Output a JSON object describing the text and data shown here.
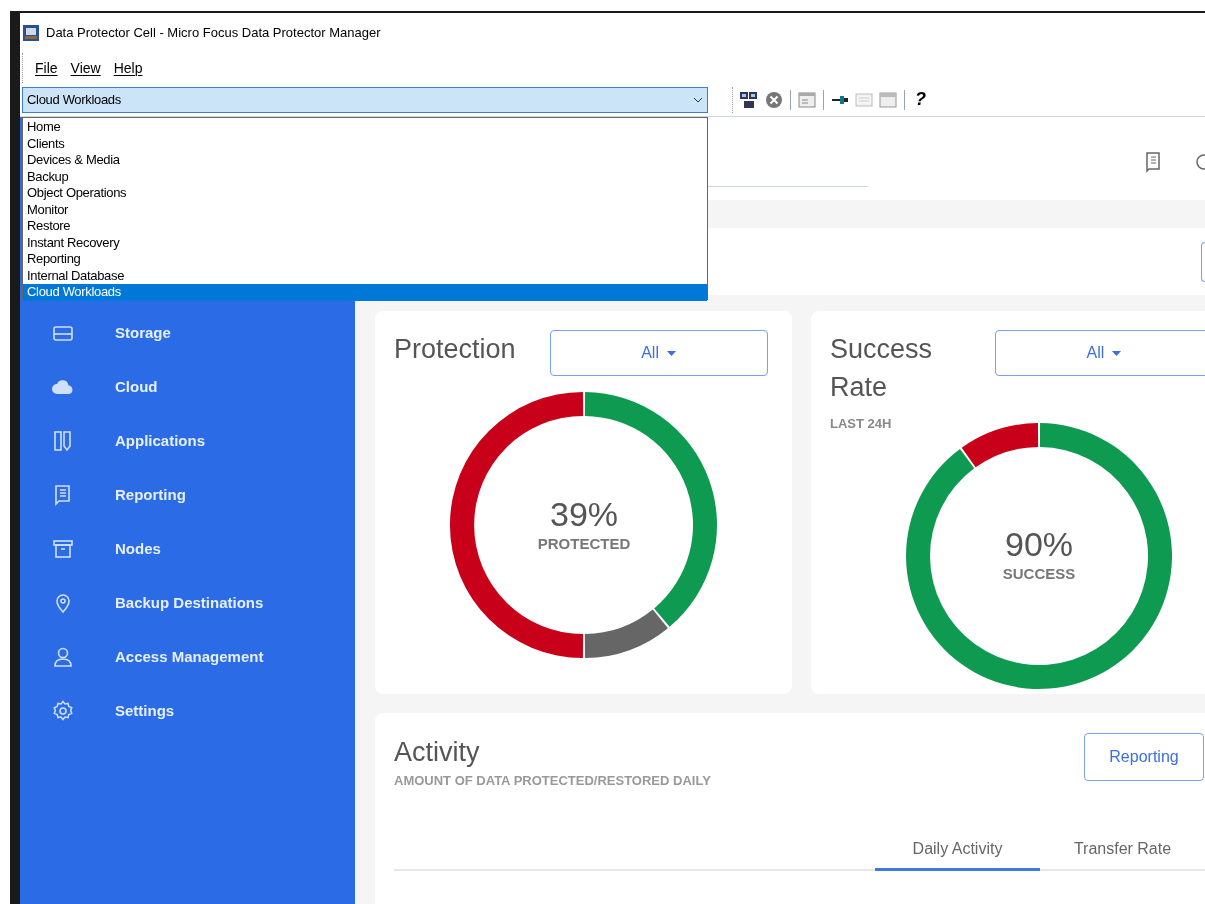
{
  "window": {
    "title": "Data Protector Cell - Micro Focus Data Protector Manager"
  },
  "menu": [
    "File",
    "View",
    "Help"
  ],
  "context_selector": {
    "value": "Cloud Workloads",
    "expanded": true,
    "options": [
      {
        "label": "Home",
        "selected": false
      },
      {
        "label": "Clients",
        "selected": false
      },
      {
        "label": "Devices & Media",
        "selected": false
      },
      {
        "label": "Backup",
        "selected": false
      },
      {
        "label": "Object Operations",
        "selected": false
      },
      {
        "label": "Monitor",
        "selected": false
      },
      {
        "label": "Restore",
        "selected": false
      },
      {
        "label": "Instant Recovery",
        "selected": false
      },
      {
        "label": "Reporting",
        "selected": false
      },
      {
        "label": "Internal Database",
        "selected": false
      },
      {
        "label": "Cloud Workloads",
        "selected": true
      }
    ]
  },
  "toolbar": {
    "help": "?"
  },
  "sidebar": {
    "items": [
      {
        "label": "Storage",
        "kind": "storage"
      },
      {
        "label": "Cloud",
        "kind": "cloud"
      },
      {
        "label": "Applications",
        "kind": "apps"
      },
      {
        "label": "Reporting",
        "kind": "report"
      },
      {
        "label": "Nodes",
        "kind": "nodes"
      },
      {
        "label": "Backup Destinations",
        "kind": "pin"
      },
      {
        "label": "Access Management",
        "kind": "user"
      },
      {
        "label": "Settings",
        "kind": "gear"
      }
    ]
  },
  "protection": {
    "title": "Protection",
    "filter": "All",
    "percent": "39%",
    "caption": "PROTECTED",
    "chart_data": {
      "type": "donut",
      "values": [
        39,
        11,
        50
      ],
      "colors": [
        "#0f9a51",
        "#666666",
        "#c8001a"
      ]
    }
  },
  "success_rate": {
    "title": "Success Rate",
    "subtitle": "LAST 24H",
    "filter": "All",
    "percent": "90%",
    "caption": "SUCCESS",
    "chart_data": {
      "type": "donut",
      "values": [
        90,
        10
      ],
      "colors": [
        "#0f9a51",
        "#c8001a"
      ]
    }
  },
  "activity": {
    "title": "Activity",
    "subtitle": "AMOUNT OF DATA PROTECTED/RESTORED DAILY",
    "button": "Reporting",
    "tabs": [
      {
        "label": "Daily Activity",
        "selected": true
      },
      {
        "label": "Transfer Rate",
        "selected": false
      }
    ]
  }
}
